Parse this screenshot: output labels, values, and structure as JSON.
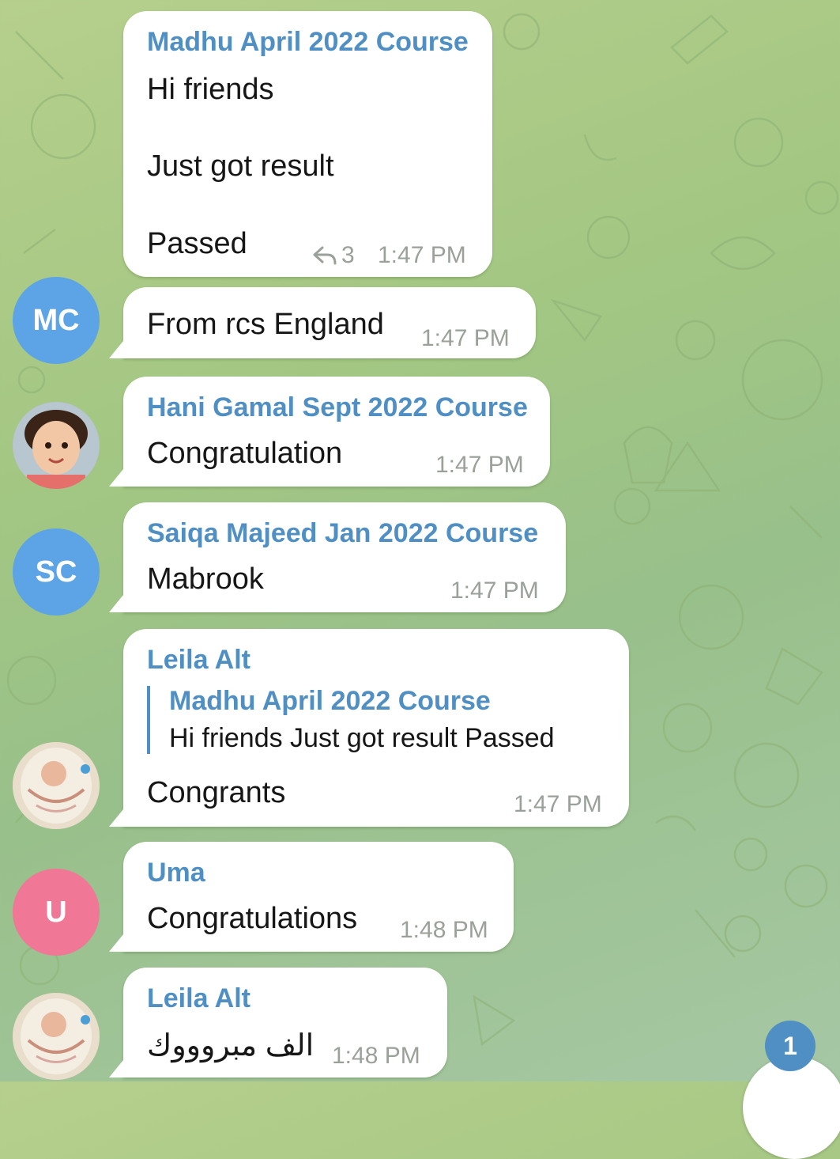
{
  "colors": {
    "accent": "#4f8fc4",
    "bubble": "#ffffff",
    "text": "#161616",
    "time": "#9aa09a",
    "avatar_mc": "#5ca4e6",
    "avatar_sc": "#5ca4e6",
    "avatar_u": "#f07796"
  },
  "messages": [
    {
      "sender": "Madhu April 2022 Course",
      "lines": [
        "Hi friends",
        "Just got result",
        "Passed"
      ],
      "forward_count": "3",
      "time": "1:47 PM"
    },
    {
      "avatar_initials": "MC",
      "text": "From rcs England",
      "time": "1:47 PM"
    },
    {
      "sender": "Hani Gamal Sept 2022 Course",
      "text": "Congratulation",
      "time": "1:47 PM",
      "avatar_icon": "child-photo-avatar"
    },
    {
      "sender": "Saiqa Majeed Jan 2022 Course",
      "avatar_initials": "SC",
      "text": "Mabrook",
      "time": "1:47 PM"
    },
    {
      "sender": "Leila Alt",
      "reply_to": {
        "sender": "Madhu April 2022 Course",
        "text": "Hi friends  Just got result   Passed"
      },
      "text": "Congrants",
      "time": "1:47 PM",
      "avatar_icon": "baby-photo-avatar"
    },
    {
      "sender": "Uma",
      "avatar_initials": "U",
      "text": "Congratulations",
      "time": "1:48 PM"
    },
    {
      "sender": "Leila Alt",
      "text": "الف مبروووك",
      "time": "1:48 PM",
      "avatar_icon": "baby-photo-avatar"
    }
  ],
  "unread_badge": "1",
  "icons": {
    "forward": "share-arrow-icon",
    "scroll_down": "scroll-down-button"
  }
}
